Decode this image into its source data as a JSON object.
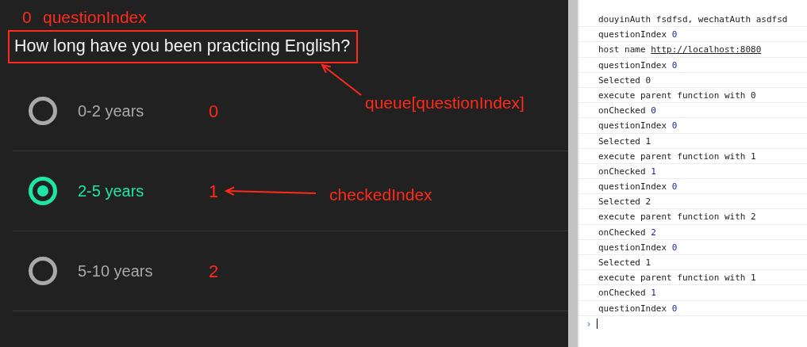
{
  "question": {
    "text": "How long have you been practicing English?"
  },
  "options": [
    {
      "label": "0-2 years",
      "selected": false,
      "annotation": "0"
    },
    {
      "label": "2-5 years",
      "selected": true,
      "annotation": "1"
    },
    {
      "label": "5-10 years",
      "selected": false,
      "annotation": "2"
    }
  ],
  "annotations": {
    "question_index_value": "0",
    "question_index_name": "questionIndex",
    "question_label": "queue[questionIndex]",
    "checked_label": "checkedIndex"
  },
  "console": {
    "entries": [
      {
        "text": "douyinAuth fsdfsd, wechatAuth asdfsd"
      },
      {
        "text": "questionIndex",
        "value": "0"
      },
      {
        "text": "host name",
        "link": "http://localhost:8080"
      },
      {
        "text": "questionIndex",
        "value": "0"
      },
      {
        "text": "Selected 0"
      },
      {
        "text": "execute parent function with 0"
      },
      {
        "text": "onChecked",
        "value": "0"
      },
      {
        "text": "questionIndex",
        "value": "0"
      },
      {
        "text": "Selected 1"
      },
      {
        "text": "execute parent function with 1"
      },
      {
        "text": "onChecked",
        "value": "1"
      },
      {
        "text": "questionIndex",
        "value": "0"
      },
      {
        "text": "Selected 2"
      },
      {
        "text": "execute parent function with 2"
      },
      {
        "text": "onChecked",
        "value": "2"
      },
      {
        "text": "questionIndex",
        "value": "0"
      },
      {
        "text": "Selected 1"
      },
      {
        "text": "execute parent function with 1"
      },
      {
        "text": "onChecked",
        "value": "1"
      },
      {
        "text": "questionIndex",
        "value": "0"
      }
    ],
    "prompt": "›"
  }
}
